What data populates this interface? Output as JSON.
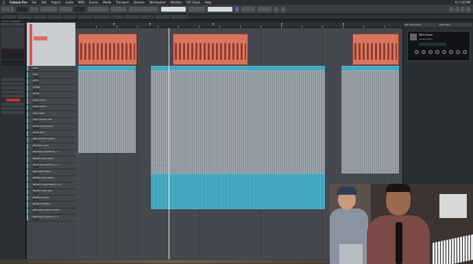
{
  "menubar": {
    "items": [
      "Cubase Pro",
      "File",
      "Edit",
      "Project",
      "Audio",
      "MIDI",
      "Scores",
      "Media",
      "Transport",
      "Devices",
      "Workspaces",
      "Window",
      "VST Cloud",
      "Help"
    ],
    "right": [
      "Fri 7:40 PM"
    ]
  },
  "status_line": "Tracks 1 Selected",
  "tracks": [
    {
      "name": "Mix",
      "color": "#d9574f"
    },
    {
      "name": "Mix",
      "color": "#d9574f"
    },
    {
      "name": "Bass",
      "color": "#4fb9d0"
    },
    {
      "name": "Keys",
      "color": "#4fb9d0"
    },
    {
      "name": "Kicks",
      "color": "#4fb9d0"
    },
    {
      "name": "Snares",
      "color": "#4fb9d0"
    },
    {
      "name": "Guitar",
      "color": "#4fb9d0"
    },
    {
      "name": "Clean Lead 1",
      "color": "#4fb9d0"
    },
    {
      "name": "Clean Lead 2",
      "color": "#4fb9d0"
    },
    {
      "name": "Clean Lead",
      "color": "#4fb9d0"
    },
    {
      "name": "Clean Octave Lead",
      "color": "#4fb9d0"
    },
    {
      "name": "Stereo Lead Guitars",
      "color": "#4fb9d0"
    },
    {
      "name": "Guitar Solo",
      "color": "#4fb9d0"
    },
    {
      "name": "Main Rhythm Guitars",
      "color": "#4fb9d0"
    },
    {
      "name": "Fast Rock Layer",
      "color": "#4fb9d0"
    },
    {
      "name": "Secondary Rhythm G...rs",
      "color": "#4fb9d0"
    },
    {
      "name": "Rhythm Lead Guitar",
      "color": "#4fb9d0"
    },
    {
      "name": "Secondary Rhythm G...rs",
      "color": "#4fb9d0"
    },
    {
      "name": "Bass Lead Guitars",
      "color": "#4fb9d0"
    },
    {
      "name": "Whistle Lead Guitars",
      "color": "#4fb9d0"
    },
    {
      "name": "Rhythm Guitar Delay C...ts",
      "color": "#4fb9d0"
    },
    {
      "name": "Rhythm Clean Gtrs",
      "color": "#4fb9d0"
    },
    {
      "name": "Rhythm All Gtrs",
      "color": "#4fb9d0"
    },
    {
      "name": "Rhythm All Bass",
      "color": "#4fb9d0"
    },
    {
      "name": "Percussion Rhythm Guitar",
      "color": "#4fb9d0"
    },
    {
      "name": "Secondary Rhythm G...rs",
      "color": "#4fb9d0"
    }
  ],
  "right_panel": {
    "tabs": [
      "VST Instruments",
      "Media Bay"
    ],
    "plugin_title": "MIDI Helper",
    "plugin_preset": "Default Patch"
  },
  "colors": {
    "midi_event": "#d9745f",
    "audio_blue": "#4fb9d0",
    "audio_gray": "#9ea4ab",
    "track_red": "#d9574f"
  }
}
